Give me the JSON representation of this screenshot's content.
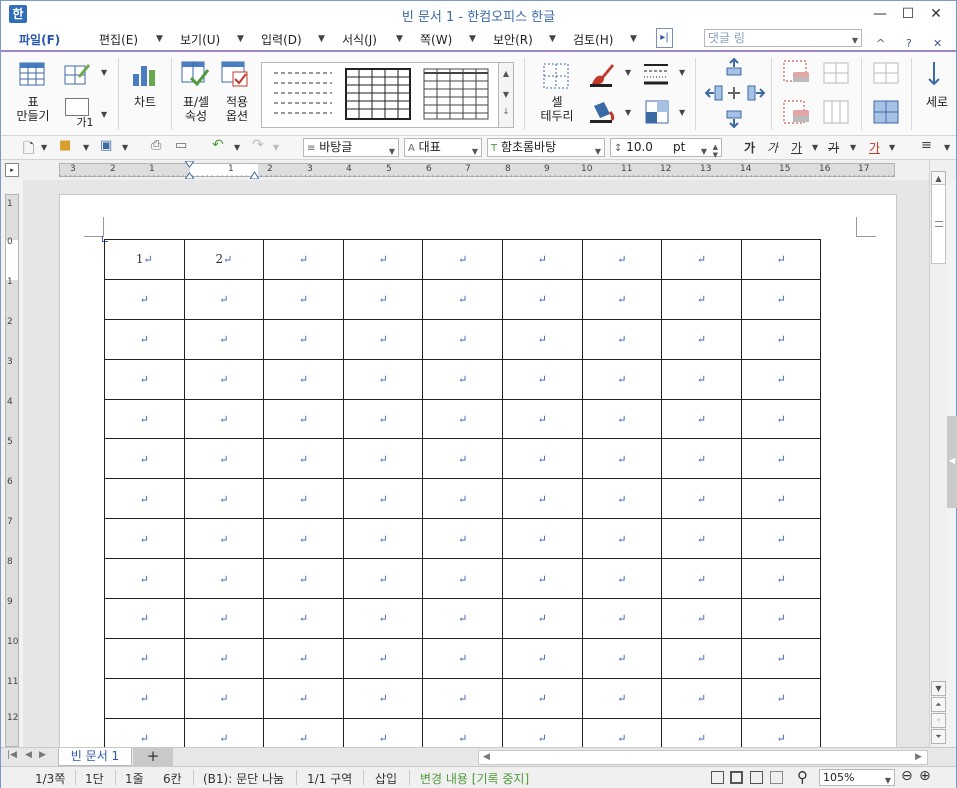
{
  "window": {
    "title": "빈 문서 1 - 한컴오피스 한글",
    "app_icon": "한",
    "controls": {
      "minimize": "—",
      "maximize": "☐",
      "close": "✕"
    }
  },
  "menu": {
    "items": [
      "파일(F)",
      "편집(E)",
      "보기(U)",
      "입력(D)",
      "서식(J)",
      "쪽(W)",
      "보안(R)",
      "검토(H)"
    ],
    "more": "▸|",
    "memo_placeholder": "댓글 링",
    "collapse": "^",
    "help": "?",
    "close": "✕"
  },
  "ribbon": {
    "table_make": [
      "표",
      "만들기"
    ],
    "caption": "가1",
    "chart": "차트",
    "table_props": [
      "표/셀",
      "속성"
    ],
    "apply_options": [
      "적용",
      "옵션"
    ],
    "cell_border": [
      "셀",
      "테두리"
    ],
    "sero": "세로"
  },
  "toolbar": {
    "style": "바탕글",
    "lang": "대표",
    "font": "함초롬바탕",
    "size": "10.0",
    "unit": "pt",
    "bold": "가",
    "italic": "가",
    "underline": "가",
    "strike": "가",
    "color": "가"
  },
  "ruler": {
    "h_labels": [
      "3",
      "2",
      "1",
      "1",
      "2",
      "3",
      "4",
      "5",
      "6",
      "7",
      "8",
      "9",
      "10",
      "11",
      "12",
      "13",
      "14",
      "15",
      "16",
      "17"
    ],
    "v_labels": [
      "1",
      "0",
      "1",
      "2",
      "3",
      "4",
      "5",
      "6",
      "7",
      "8",
      "9",
      "10",
      "11",
      "12"
    ]
  },
  "table": {
    "rows": 13,
    "cols": 9,
    "first_row": [
      "1",
      "2",
      "",
      "",
      "",
      "",
      "",
      "",
      ""
    ],
    "para_mark": "↵"
  },
  "tabs": {
    "doc_tab": "빈 문서 1",
    "add": "+"
  },
  "status": {
    "page": "1/3쪽",
    "column": "1단",
    "line": "1줄",
    "col": "6칸",
    "cell": "(B1): 문단 나눔",
    "section": "1/1 구역",
    "mode": "삽입",
    "track": "변경 내용 [기록 중지]",
    "zoom": "105%"
  }
}
